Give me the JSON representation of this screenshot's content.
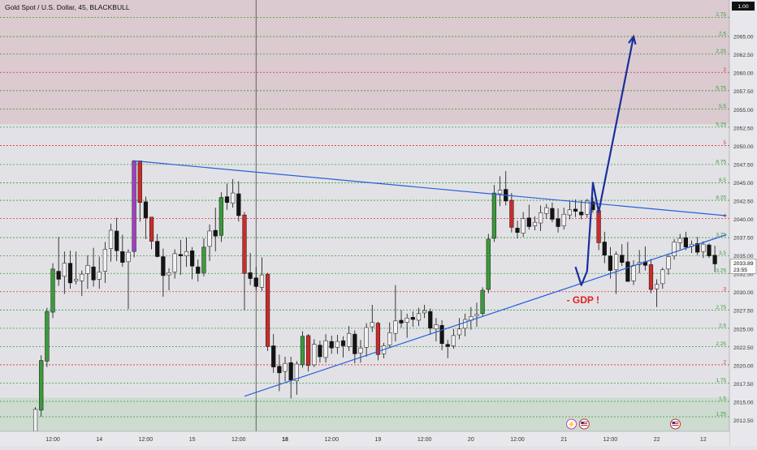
{
  "header": {
    "title": "Gold Spot / U.S. Dollar, 45, BLACKBULL"
  },
  "chart_data": {
    "type": "candlestick",
    "symbol": "XAUUSD",
    "ylim": [
      2011.0,
      2070.0
    ],
    "x_count": 120,
    "y_ticks": [
      2012.5,
      2015.0,
      2017.5,
      2020.0,
      2022.5,
      2025.0,
      2027.5,
      2030.0,
      2032.5,
      2035.0,
      2037.5,
      2040.0,
      2042.5,
      2045.0,
      2047.5,
      2050.0,
      2052.5,
      2055.0,
      2057.5,
      2060.0,
      2062.5,
      2065.0
    ],
    "y_tick_labels": [
      "2012.50",
      "2015.00",
      "2017.50",
      "2020.00",
      "2022.50",
      "2025.00",
      "2027.50",
      "2030.00",
      "2032.50",
      "2035.00",
      "2037.50",
      "2040.00",
      "2042.50",
      "2045.00",
      "2047.50",
      "2050.00",
      "2052.50",
      "2055.00",
      "2057.50",
      "2060.00",
      "2062.50",
      "2065.00"
    ],
    "x_ticks": [
      {
        "label": "12:00",
        "i": 3
      },
      {
        "label": "14",
        "i": 11
      },
      {
        "label": "12:00",
        "i": 19
      },
      {
        "label": "15",
        "i": 27
      },
      {
        "label": "12:00",
        "i": 35
      },
      {
        "label": "18",
        "i": 43
      },
      {
        "label": "12:00",
        "i": 51
      },
      {
        "label": "19",
        "i": 59
      },
      {
        "label": "12:00",
        "i": 67
      },
      {
        "label": "20",
        "i": 75
      },
      {
        "label": "12:00",
        "i": 83
      },
      {
        "label": "21",
        "i": 91
      },
      {
        "label": "12:00",
        "i": 99
      },
      {
        "label": "22",
        "i": 107
      },
      {
        "label": "12",
        "i": 115
      }
    ],
    "current_price": "2033.89",
    "countdown": "23:55",
    "top_badge": "1.00",
    "fib_levels": [
      {
        "label": "1.25",
        "price": 2013.0,
        "color": "#3a9a3a"
      },
      {
        "label": "1.5",
        "price": 2015.1,
        "color": "#3a9a3a"
      },
      {
        "label": "1.75",
        "price": 2017.6,
        "color": "#3a9a3a"
      },
      {
        "label": "2",
        "price": 2020.1,
        "color": "#e03030"
      },
      {
        "label": "2.25",
        "price": 2022.6,
        "color": "#3a9a3a"
      },
      {
        "label": "2.5",
        "price": 2025.1,
        "color": "#3a9a3a"
      },
      {
        "label": "2.75",
        "price": 2027.6,
        "color": "#3a9a3a"
      },
      {
        "label": "3",
        "price": 2030.1,
        "color": "#e03030"
      },
      {
        "label": "3.25",
        "price": 2032.6,
        "color": "#3a9a3a"
      },
      {
        "label": "3.5",
        "price": 2035.0,
        "color": "#3a9a3a"
      },
      {
        "label": "3.75",
        "price": 2037.5,
        "color": "#3a9a3a"
      },
      {
        "label": "4",
        "price": 2040.1,
        "color": "#e03030"
      },
      {
        "label": "8.25",
        "price": 2042.6,
        "color": "#3a9a3a"
      },
      {
        "label": "8.5",
        "price": 2045.0,
        "color": "#3a9a3a"
      },
      {
        "label": "8.75",
        "price": 2047.5,
        "color": "#3a9a3a"
      },
      {
        "label": "5",
        "price": 2050.1,
        "color": "#e03030"
      },
      {
        "label": "5.25",
        "price": 2052.6,
        "color": "#3a9a3a"
      },
      {
        "label": "5.5",
        "price": 2055.1,
        "color": "#3a9a3a"
      },
      {
        "label": "5.75",
        "price": 2057.6,
        "color": "#3a9a3a"
      },
      {
        "label": "2",
        "price": 2060.1,
        "color": "#e03030"
      },
      {
        "label": "2.25",
        "price": 2062.6,
        "color": "#3a9a3a"
      },
      {
        "label": "2.5",
        "price": 2065.0,
        "color": "#3a9a3a"
      },
      {
        "label": "2.75",
        "price": 2067.6,
        "color": "#3a9a3a"
      }
    ],
    "zones": [
      {
        "from": 2053.0,
        "to": 2070.0,
        "color": "rgba(200,140,150,0.28)"
      },
      {
        "from": 2011.0,
        "to": 2015.6,
        "color": "rgba(150,200,150,0.28)"
      }
    ],
    "candles": [
      {
        "o": 2011.0,
        "h": 2014.3,
        "l": 2010.8,
        "c": 2014.0
      },
      {
        "o": 2013.9,
        "h": 2021.4,
        "l": 2013.0,
        "c": 2020.7
      },
      {
        "o": 2020.6,
        "h": 2027.9,
        "l": 2019.8,
        "c": 2027.4
      },
      {
        "o": 2027.3,
        "h": 2034.0,
        "l": 2026.5,
        "c": 2033.2
      },
      {
        "o": 2032.9,
        "h": 2037.6,
        "l": 2030.9,
        "c": 2031.8
      },
      {
        "o": 2032.2,
        "h": 2035.6,
        "l": 2029.8,
        "c": 2034.0
      },
      {
        "o": 2034.0,
        "h": 2035.7,
        "l": 2030.5,
        "c": 2031.3
      },
      {
        "o": 2031.6,
        "h": 2035.6,
        "l": 2031.1,
        "c": 2031.8
      },
      {
        "o": 2031.6,
        "h": 2033.0,
        "l": 2029.5,
        "c": 2032.5
      },
      {
        "o": 2032.6,
        "h": 2035.1,
        "l": 2030.5,
        "c": 2033.7
      },
      {
        "o": 2033.5,
        "h": 2036.1,
        "l": 2030.8,
        "c": 2031.7
      },
      {
        "o": 2031.8,
        "h": 2034.9,
        "l": 2030.5,
        "c": 2032.8
      },
      {
        "o": 2032.9,
        "h": 2036.9,
        "l": 2031.3,
        "c": 2035.9
      },
      {
        "o": 2036.0,
        "h": 2039.4,
        "l": 2034.2,
        "c": 2038.5
      },
      {
        "o": 2038.4,
        "h": 2040.2,
        "l": 2034.3,
        "c": 2035.7
      },
      {
        "o": 2035.6,
        "h": 2037.9,
        "l": 2033.5,
        "c": 2034.1
      },
      {
        "o": 2034.2,
        "h": 2035.9,
        "l": 2027.7,
        "c": 2035.5
      },
      {
        "o": 2035.6,
        "h": 2048.1,
        "l": 2034.8,
        "c": 2048.0
      },
      {
        "o": 2048.0,
        "h": 2048.0,
        "l": 2039.7,
        "c": 2042.3
      },
      {
        "o": 2042.4,
        "h": 2043.1,
        "l": 2037.3,
        "c": 2040.2
      },
      {
        "o": 2040.3,
        "h": 2040.3,
        "l": 2035.9,
        "c": 2037.0
      },
      {
        "o": 2037.0,
        "h": 2038.0,
        "l": 2034.8,
        "c": 2034.9
      },
      {
        "o": 2034.9,
        "h": 2036.0,
        "l": 2029.4,
        "c": 2032.3
      },
      {
        "o": 2032.4,
        "h": 2033.3,
        "l": 2030.3,
        "c": 2032.7
      },
      {
        "o": 2032.8,
        "h": 2035.9,
        "l": 2031.9,
        "c": 2035.3
      },
      {
        "o": 2035.2,
        "h": 2037.2,
        "l": 2032.4,
        "c": 2035.0
      },
      {
        "o": 2035.0,
        "h": 2037.5,
        "l": 2033.5,
        "c": 2035.6
      },
      {
        "o": 2035.7,
        "h": 2036.2,
        "l": 2031.8,
        "c": 2033.6
      },
      {
        "o": 2033.5,
        "h": 2034.5,
        "l": 2031.5,
        "c": 2032.6
      },
      {
        "o": 2032.7,
        "h": 2037.4,
        "l": 2032.2,
        "c": 2036.2
      },
      {
        "o": 2036.3,
        "h": 2039.3,
        "l": 2034.3,
        "c": 2038.4
      },
      {
        "o": 2038.5,
        "h": 2041.6,
        "l": 2035.6,
        "c": 2037.7
      },
      {
        "o": 2037.8,
        "h": 2043.7,
        "l": 2036.9,
        "c": 2043.0
      },
      {
        "o": 2043.1,
        "h": 2044.9,
        "l": 2041.3,
        "c": 2042.3
      },
      {
        "o": 2042.2,
        "h": 2045.5,
        "l": 2041.6,
        "c": 2043.6
      },
      {
        "o": 2043.5,
        "h": 2045.2,
        "l": 2039.7,
        "c": 2040.5
      },
      {
        "o": 2040.6,
        "h": 2041.0,
        "l": 2027.6,
        "c": 2032.6
      },
      {
        "o": 2032.7,
        "h": 2035.4,
        "l": 2031.0,
        "c": 2031.9
      },
      {
        "o": 2032.0,
        "h": 2033.5,
        "l": 2030.3,
        "c": 2030.8
      },
      {
        "o": 2030.7,
        "h": 2034.8,
        "l": 2030.2,
        "c": 2032.4
      },
      {
        "o": 2032.5,
        "h": 2032.7,
        "l": 2022.0,
        "c": 2022.6
      },
      {
        "o": 2022.7,
        "h": 2024.3,
        "l": 2019.0,
        "c": 2019.8
      },
      {
        "o": 2019.9,
        "h": 2021.5,
        "l": 2016.5,
        "c": 2019.0
      },
      {
        "o": 2019.2,
        "h": 2021.2,
        "l": 2017.8,
        "c": 2020.3
      },
      {
        "o": 2020.4,
        "h": 2021.2,
        "l": 2015.5,
        "c": 2018.0
      },
      {
        "o": 2017.9,
        "h": 2020.6,
        "l": 2016.0,
        "c": 2020.2
      },
      {
        "o": 2020.1,
        "h": 2024.7,
        "l": 2019.7,
        "c": 2024.0
      },
      {
        "o": 2024.1,
        "h": 2024.3,
        "l": 2019.2,
        "c": 2020.0
      },
      {
        "o": 2020.1,
        "h": 2023.6,
        "l": 2019.8,
        "c": 2022.9
      },
      {
        "o": 2022.8,
        "h": 2023.4,
        "l": 2020.4,
        "c": 2021.2
      },
      {
        "o": 2021.1,
        "h": 2024.3,
        "l": 2020.4,
        "c": 2023.4
      },
      {
        "o": 2023.3,
        "h": 2024.1,
        "l": 2021.6,
        "c": 2022.4
      },
      {
        "o": 2022.5,
        "h": 2024.2,
        "l": 2021.6,
        "c": 2023.3
      },
      {
        "o": 2023.4,
        "h": 2024.0,
        "l": 2021.1,
        "c": 2022.7
      },
      {
        "o": 2022.6,
        "h": 2025.4,
        "l": 2022.0,
        "c": 2024.4
      },
      {
        "o": 2024.3,
        "h": 2024.8,
        "l": 2020.3,
        "c": 2021.6
      },
      {
        "o": 2021.7,
        "h": 2023.5,
        "l": 2020.4,
        "c": 2022.4
      },
      {
        "o": 2022.5,
        "h": 2025.8,
        "l": 2021.2,
        "c": 2025.2
      },
      {
        "o": 2025.3,
        "h": 2028.3,
        "l": 2024.6,
        "c": 2025.9
      },
      {
        "o": 2025.8,
        "h": 2026.0,
        "l": 2020.7,
        "c": 2021.5
      },
      {
        "o": 2021.6,
        "h": 2023.1,
        "l": 2021.0,
        "c": 2022.7
      },
      {
        "o": 2022.8,
        "h": 2025.9,
        "l": 2022.4,
        "c": 2024.5
      },
      {
        "o": 2024.4,
        "h": 2031.0,
        "l": 2023.3,
        "c": 2026.1
      },
      {
        "o": 2026.2,
        "h": 2027.6,
        "l": 2025.2,
        "c": 2025.8
      },
      {
        "o": 2025.9,
        "h": 2027.1,
        "l": 2023.8,
        "c": 2026.5
      },
      {
        "o": 2026.6,
        "h": 2027.4,
        "l": 2025.3,
        "c": 2026.3
      },
      {
        "o": 2026.2,
        "h": 2027.9,
        "l": 2025.4,
        "c": 2027.1
      },
      {
        "o": 2027.2,
        "h": 2028.3,
        "l": 2026.5,
        "c": 2027.5
      },
      {
        "o": 2027.4,
        "h": 2027.8,
        "l": 2024.2,
        "c": 2025.1
      },
      {
        "o": 2025.0,
        "h": 2026.5,
        "l": 2023.3,
        "c": 2025.6
      },
      {
        "o": 2025.5,
        "h": 2026.2,
        "l": 2022.1,
        "c": 2023.0
      },
      {
        "o": 2022.9,
        "h": 2023.5,
        "l": 2021.0,
        "c": 2022.6
      },
      {
        "o": 2022.7,
        "h": 2025.0,
        "l": 2022.3,
        "c": 2024.1
      },
      {
        "o": 2024.2,
        "h": 2026.5,
        "l": 2023.6,
        "c": 2025.0
      },
      {
        "o": 2025.1,
        "h": 2027.1,
        "l": 2024.0,
        "c": 2026.3
      },
      {
        "o": 2026.2,
        "h": 2028.0,
        "l": 2024.9,
        "c": 2026.7
      },
      {
        "o": 2026.8,
        "h": 2028.6,
        "l": 2025.3,
        "c": 2027.0
      },
      {
        "o": 2027.1,
        "h": 2030.7,
        "l": 2026.8,
        "c": 2030.3
      },
      {
        "o": 2030.4,
        "h": 2038.0,
        "l": 2029.9,
        "c": 2037.3
      },
      {
        "o": 2037.4,
        "h": 2044.7,
        "l": 2036.9,
        "c": 2043.6
      },
      {
        "o": 2043.5,
        "h": 2045.9,
        "l": 2041.8,
        "c": 2044.0
      },
      {
        "o": 2044.1,
        "h": 2046.6,
        "l": 2041.9,
        "c": 2042.5
      },
      {
        "o": 2042.6,
        "h": 2043.6,
        "l": 2038.2,
        "c": 2038.9
      },
      {
        "o": 2038.8,
        "h": 2039.8,
        "l": 2037.4,
        "c": 2038.2
      },
      {
        "o": 2038.1,
        "h": 2041.0,
        "l": 2037.6,
        "c": 2040.1
      },
      {
        "o": 2040.2,
        "h": 2042.0,
        "l": 2038.6,
        "c": 2039.0
      },
      {
        "o": 2039.1,
        "h": 2040.4,
        "l": 2038.5,
        "c": 2039.6
      },
      {
        "o": 2039.5,
        "h": 2041.9,
        "l": 2038.4,
        "c": 2040.9
      },
      {
        "o": 2040.8,
        "h": 2042.1,
        "l": 2040.1,
        "c": 2041.6
      },
      {
        "o": 2041.5,
        "h": 2042.3,
        "l": 2039.6,
        "c": 2040.0
      },
      {
        "o": 2040.1,
        "h": 2041.5,
        "l": 2038.2,
        "c": 2039.0
      },
      {
        "o": 2039.1,
        "h": 2041.6,
        "l": 2038.6,
        "c": 2040.7
      },
      {
        "o": 2040.6,
        "h": 2042.4,
        "l": 2040.0,
        "c": 2041.3
      },
      {
        "o": 2041.4,
        "h": 2042.7,
        "l": 2040.3,
        "c": 2041.1
      },
      {
        "o": 2041.0,
        "h": 2042.6,
        "l": 2040.0,
        "c": 2040.6
      },
      {
        "o": 2040.7,
        "h": 2042.8,
        "l": 2040.2,
        "c": 2042.5
      },
      {
        "o": 2042.4,
        "h": 2043.0,
        "l": 2040.9,
        "c": 2041.3
      },
      {
        "o": 2041.2,
        "h": 2041.6,
        "l": 2035.8,
        "c": 2036.8
      },
      {
        "o": 2036.9,
        "h": 2038.3,
        "l": 2034.0,
        "c": 2035.1
      },
      {
        "o": 2035.0,
        "h": 2036.2,
        "l": 2031.9,
        "c": 2033.0
      },
      {
        "o": 2033.1,
        "h": 2035.6,
        "l": 2029.8,
        "c": 2035.2
      },
      {
        "o": 2035.1,
        "h": 2036.6,
        "l": 2033.6,
        "c": 2034.1
      },
      {
        "o": 2034.2,
        "h": 2036.9,
        "l": 2032.3,
        "c": 2031.5
      },
      {
        "o": 2031.6,
        "h": 2034.4,
        "l": 2031.0,
        "c": 2033.7
      },
      {
        "o": 2033.8,
        "h": 2035.8,
        "l": 2032.6,
        "c": 2034.1
      },
      {
        "o": 2034.2,
        "h": 2036.3,
        "l": 2033.0,
        "c": 2033.7
      },
      {
        "o": 2033.8,
        "h": 2034.6,
        "l": 2029.9,
        "c": 2030.4
      },
      {
        "o": 2030.5,
        "h": 2031.8,
        "l": 2028.0,
        "c": 2031.1
      },
      {
        "o": 2031.2,
        "h": 2033.4,
        "l": 2030.5,
        "c": 2033.1
      },
      {
        "o": 2033.2,
        "h": 2035.2,
        "l": 2032.4,
        "c": 2034.9
      },
      {
        "o": 2035.0,
        "h": 2037.3,
        "l": 2034.5,
        "c": 2036.9
      },
      {
        "o": 2036.8,
        "h": 2038.0,
        "l": 2035.9,
        "c": 2037.4
      },
      {
        "o": 2037.5,
        "h": 2038.3,
        "l": 2035.8,
        "c": 2036.2
      },
      {
        "o": 2036.3,
        "h": 2037.1,
        "l": 2035.4,
        "c": 2036.6
      },
      {
        "o": 2036.7,
        "h": 2037.6,
        "l": 2035.1,
        "c": 2035.5
      },
      {
        "o": 2035.6,
        "h": 2037.0,
        "l": 2034.7,
        "c": 2036.6
      },
      {
        "o": 2036.5,
        "h": 2036.7,
        "l": 2034.7,
        "c": 2035.0
      },
      {
        "o": 2035.1,
        "h": 2036.4,
        "l": 2032.8,
        "c": 2033.9
      }
    ],
    "highlight_candles": [
      {
        "i": 17,
        "color": "#a040c0"
      }
    ],
    "trendlines": [
      {
        "points": [
          [
            17,
            2048.0
          ],
          [
            119,
            2040.5
          ]
        ],
        "color": "#2a5fd8",
        "width": 1.2
      },
      {
        "points": [
          [
            36,
            2015.8
          ],
          [
            119,
            2037.9
          ]
        ],
        "color": "#2a5fd8",
        "width": 1.2
      }
    ],
    "projection": {
      "points": [
        [
          93,
          2033.5
        ],
        [
          94,
          2031.0
        ],
        [
          95,
          2032.9
        ],
        [
          96,
          2045.0
        ],
        [
          97,
          2041.0
        ],
        [
          103,
          2065.0
        ]
      ],
      "color": "#1a2f9a",
      "width": 2.2
    },
    "annotations": [
      {
        "text": "- GDP !",
        "i": 94.3,
        "price": 2028.5,
        "color": "#e02020"
      }
    ],
    "vertical_marker": {
      "i": 38,
      "color": "#555555"
    },
    "event_icons": [
      {
        "i": 92.3,
        "label": "⚡",
        "color": "#c23fb0"
      },
      {
        "i": 94.5,
        "label": "🇺🇸",
        "color": "#c03030"
      },
      {
        "i": 110.2,
        "label": "🇺🇸",
        "color": "#c03030"
      }
    ],
    "grid": false,
    "legend": "none"
  }
}
